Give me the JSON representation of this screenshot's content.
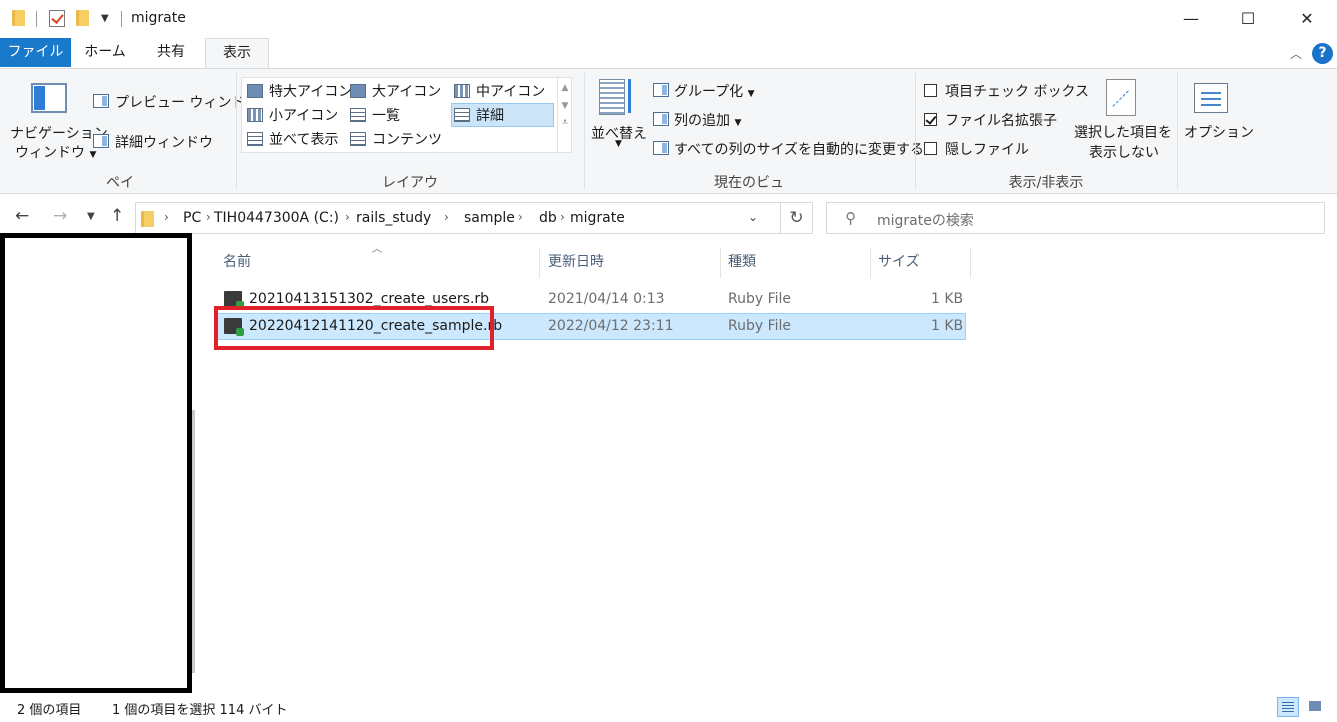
{
  "window": {
    "title": "migrate",
    "minimize": "—",
    "maximize": "☐",
    "close": "✕"
  },
  "tabs": [
    {
      "label": "ファイル"
    },
    {
      "label": "ホーム"
    },
    {
      "label": "共有"
    },
    {
      "label": "表示"
    }
  ],
  "ribbon": {
    "pane": {
      "group_label": "ペイン",
      "nav_pane_line1": "ナビゲーション",
      "nav_pane_line2": "ウィンドウ",
      "preview": "プレビュー ウィンドウ",
      "details": "詳細ウィンドウ"
    },
    "layout": {
      "group_label": "レイアウト",
      "extra_large": "特大アイコン",
      "large": "大アイコン",
      "medium": "中アイコン",
      "small": "小アイコン",
      "list": "一覧",
      "details": "詳細",
      "tiles": "並べて表示",
      "content": "コンテンツ"
    },
    "current_view": {
      "group_label": "現在のビュー",
      "sort": "並べ替え",
      "group_by": "グループ化",
      "add_columns": "列の追加",
      "size_all": "すべての列のサイズを自動的に変更する"
    },
    "show_hide": {
      "group_label": "表示/非表示",
      "item_checkboxes": "項目チェック ボックス",
      "file_extensions": "ファイル名拡張子",
      "hidden_items": "隠しファイル",
      "hide_selected_line1": "選択した項目を",
      "hide_selected_line2": "表示しない"
    },
    "options": "オプション"
  },
  "address": {
    "crumbs": [
      "PC",
      "TIH0447300A (C:)",
      "rails_study",
      "sample",
      "db",
      "migrate"
    ],
    "search_placeholder": "migrateの検索"
  },
  "columns": {
    "name": "名前",
    "modified": "更新日時",
    "type": "種類",
    "size": "サイズ"
  },
  "files": [
    {
      "name": "20210413151302_create_users.rb",
      "modified": "2021/04/14 0:13",
      "type": "Ruby File",
      "size": "1 KB"
    },
    {
      "name": "20220412141120_create_sample.rb",
      "modified": "2022/04/12 23:11",
      "type": "Ruby File",
      "size": "1 KB"
    }
  ],
  "status": {
    "item_count": "2 個の項目",
    "selected": "1 個の項目を選択  114 バイト"
  }
}
